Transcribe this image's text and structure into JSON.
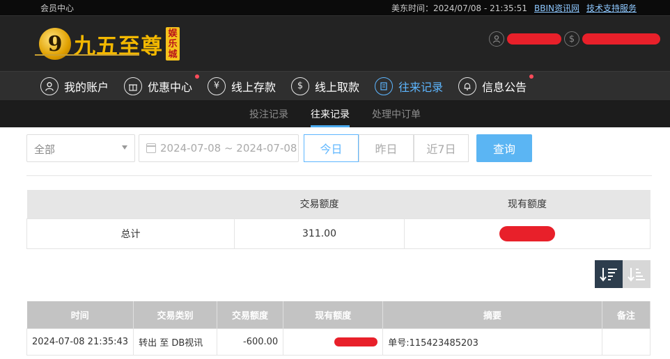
{
  "topbar": {
    "member_center": "会员中心",
    "time_label": "美东时间：2024/07/08 - 21:35:51",
    "link1": "BBIN资讯网",
    "link2": "技术支持服务"
  },
  "logo": {
    "mark": "9",
    "text": "九五至尊",
    "badge": [
      "娱",
      "乐",
      "城"
    ]
  },
  "header": {
    "user_icon": "user-icon",
    "money_icon": "dollar-icon"
  },
  "mainnav": [
    {
      "label": "我的账户",
      "icon": "user-icon",
      "dot": false,
      "active": false
    },
    {
      "label": "优惠中心",
      "icon": "gift-icon",
      "dot": true,
      "active": false
    },
    {
      "label": "线上存款",
      "icon": "deposit-icon",
      "dot": false,
      "active": false
    },
    {
      "label": "线上取款",
      "icon": "withdraw-icon",
      "dot": false,
      "active": false
    },
    {
      "label": "往来记录",
      "icon": "record-icon",
      "dot": false,
      "active": true
    },
    {
      "label": "信息公告",
      "icon": "bell-icon",
      "dot": true,
      "active": false
    }
  ],
  "subnav": [
    {
      "label": "投注记录",
      "active": false
    },
    {
      "label": "往来记录",
      "active": true
    },
    {
      "label": "处理中订单",
      "active": false
    }
  ],
  "filters": {
    "type_select": "全部",
    "date_range": "2024-07-08 ~ 2024-07-08",
    "today": "今日",
    "yesterday": "昨日",
    "last7": "近7日",
    "search": "查询"
  },
  "summary": {
    "col_amount": "交易额度",
    "col_balance": "现有额度",
    "row_label": "总计",
    "amount": "311.00"
  },
  "records": {
    "headers": [
      "时间",
      "交易类别",
      "交易额度",
      "现有额度",
      "摘要",
      "备注"
    ],
    "rows": [
      {
        "time": "2024-07-08 21:35:43",
        "type": "转出 至 DB视讯",
        "amount": "-600.00",
        "summary": "单号:115423485203",
        "note": ""
      }
    ]
  },
  "colors": {
    "accent": "#5db6ff",
    "redaction": "#e8202a",
    "logo_gold": "#f3b800"
  }
}
